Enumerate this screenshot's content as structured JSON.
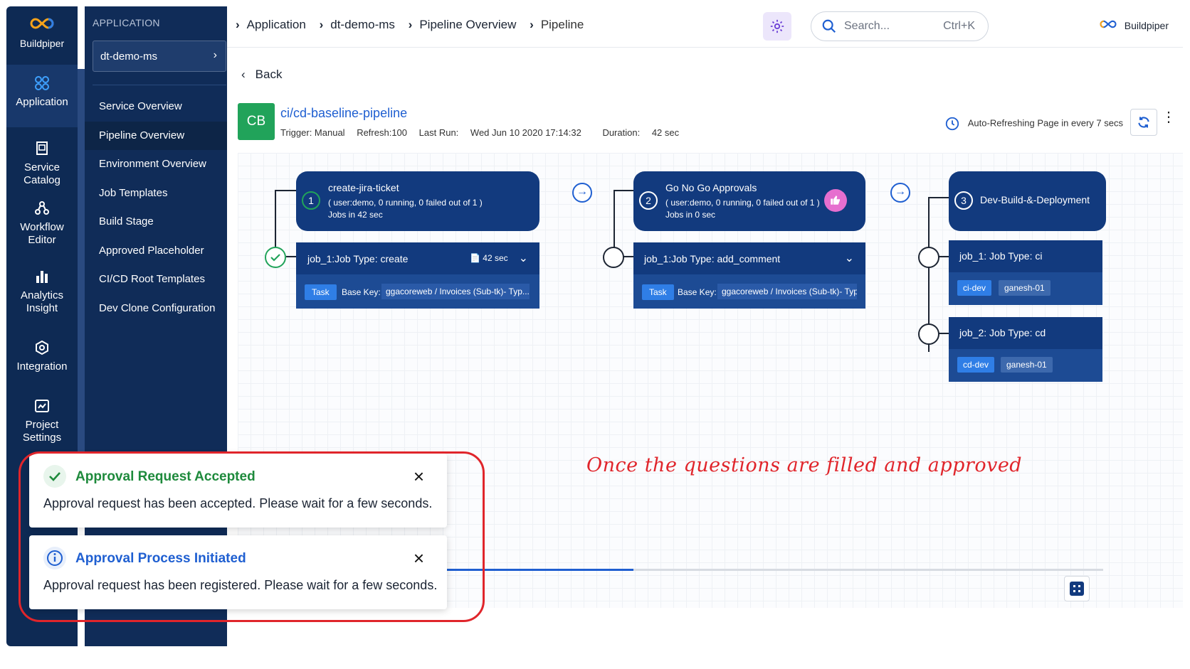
{
  "rail": {
    "brand": "Buildpiper",
    "items": [
      {
        "label": "Application",
        "icon": "grid-circles-icon"
      },
      {
        "label": "Service Catalog",
        "icon": "catalog-icon"
      },
      {
        "label": "Workflow Editor",
        "icon": "workflow-icon"
      },
      {
        "label": "Analytics Insight",
        "icon": "bar-chart-icon"
      },
      {
        "label": "Integration",
        "icon": "integration-icon"
      },
      {
        "label": "Project Settings",
        "icon": "settings-icon"
      }
    ]
  },
  "sidebar": {
    "header": "APPLICATION",
    "selected_app": "dt-demo-ms",
    "items": [
      "Service Overview",
      "Pipeline Overview",
      "Environment Overview",
      "Job Templates",
      "Build Stage",
      "Approved Placeholder",
      "CI/CD Root Templates",
      "Dev Clone Configuration"
    ]
  },
  "topbar": {
    "breadcrumbs": [
      "Application",
      "dt-demo-ms",
      "Pipeline Overview",
      "Pipeline"
    ],
    "search_placeholder": "Search...",
    "search_shortcut": "Ctrl+K",
    "brand": "Buildpiper"
  },
  "pipeline": {
    "back_label": "Back",
    "badge": "CB",
    "name": "ci/cd-baseline-pipeline",
    "trigger": "Trigger: Manual",
    "refresh": "Refresh:100",
    "last_run_label": "Last Run:",
    "last_run": "Wed Jun 10 2020 17:14:32",
    "duration_label": "Duration:",
    "duration": "42 sec",
    "auto_refresh": "Auto-Refreshing Page in every 7 secs"
  },
  "stages": [
    {
      "num": "1",
      "name": "create-jira-ticket",
      "summary": "( user:demo, 0 running, 0 failed out of 1 )",
      "jobs_time": "Jobs in 42 sec",
      "job": {
        "title": "job_1:Job Type: create",
        "time": "42 sec",
        "task": "Task",
        "base_key_label": "Base Key:",
        "base_key": "ggacoreweb / Invoices (Sub-tk)- Typ..."
      }
    },
    {
      "num": "2",
      "name": "Go No Go Approvals",
      "summary": "( user:demo, 0 running, 0 failed out of 1 )",
      "jobs_time": "Jobs in 0 sec",
      "job": {
        "title": "job_1:Job Type: add_comment",
        "task": "Task",
        "base_key_label": "Base Key:",
        "base_key": "ggacoreweb / Invoices (Sub-tk)- Typ..."
      }
    },
    {
      "num": "3",
      "name": "Dev-Build-&-Deployment",
      "jobs": [
        {
          "title": "job_1: Job Type: ci",
          "env": "ci-dev",
          "user": "ganesh-01"
        },
        {
          "title": "job_2: Job Type: cd",
          "env": "cd-dev",
          "user": "ganesh-01"
        }
      ]
    }
  ],
  "annotation": "Once the questions are filled and approved",
  "progress_fraction": 0.284,
  "toasts": [
    {
      "title": "Approval Request Accepted",
      "body": "Approval request has been accepted. Please wait for a few seconds.",
      "color": "#1e8a3c"
    },
    {
      "title": "Approval Process Initiated",
      "body": "Approval request has been registered. Please wait for a few seconds.",
      "color": "#1f5fd1"
    }
  ],
  "colors": {
    "accent": "#1f5fd1",
    "navy": "#0e2a54",
    "success": "#21a35a",
    "highlight": "#e0252b"
  }
}
